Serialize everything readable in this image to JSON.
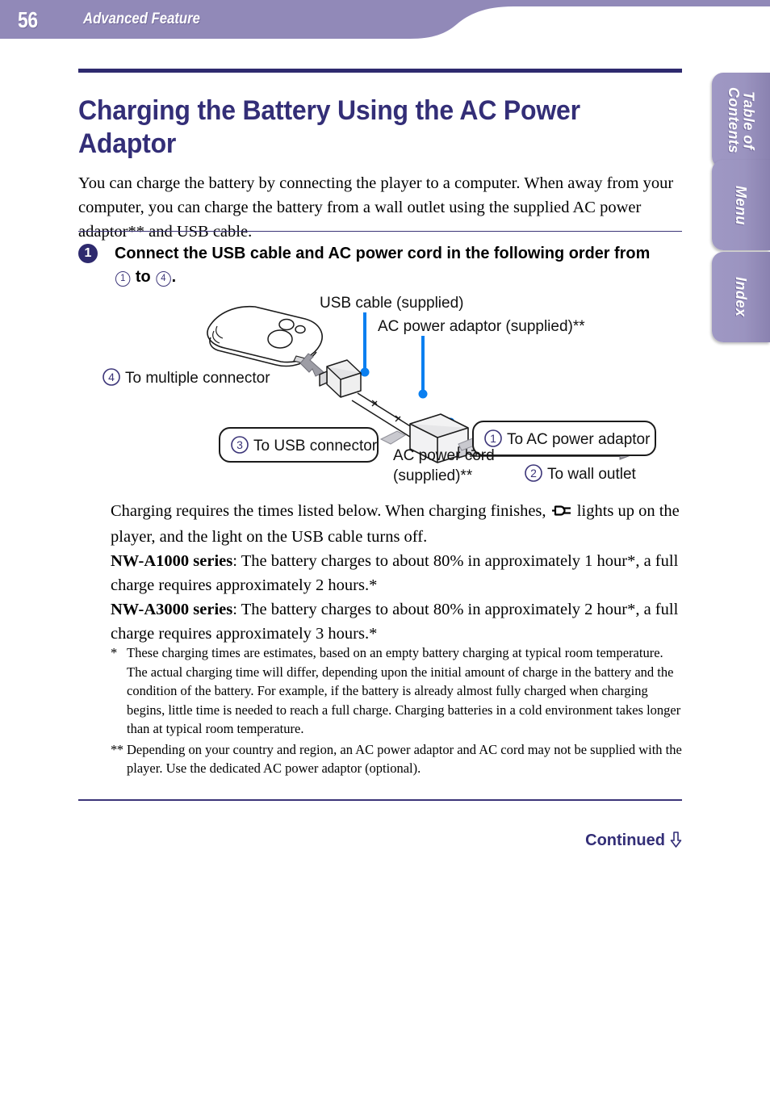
{
  "header": {
    "page_number": "56",
    "section_title": "Advanced Feature",
    "band_color": "#9189b8"
  },
  "side_tabs": [
    {
      "id": "toc",
      "label": "Table of\nContents"
    },
    {
      "id": "menu",
      "label": "Menu"
    },
    {
      "id": "index",
      "label": "Index"
    }
  ],
  "title": "Charging the Battery Using the AC Power Adaptor",
  "intro": "You can charge the battery by connecting the player to a computer. When away from your computer, you can charge the battery from a wall outlet using the supplied AC power adaptor** and USB cable.",
  "step": {
    "number": "1",
    "text_before": "Connect the USB cable and AC power cord in the following order from ",
    "circle_from": "1",
    "text_middle": " to ",
    "circle_to": "4",
    "text_after": "."
  },
  "diagram": {
    "labels": {
      "usb_cable": "USB cable (supplied)",
      "ac_power_adaptor": "AC power adaptor (supplied)**",
      "ac_power_cord_line1": "AC power cord",
      "ac_power_cord_line2": "(supplied)**"
    },
    "callouts": [
      {
        "number": "4",
        "text": "To multiple connector",
        "boxed": false
      },
      {
        "number": "3",
        "text": "To USB connector",
        "boxed": true
      },
      {
        "number": "1",
        "text": "To AC power adaptor",
        "boxed": true
      },
      {
        "number": "2",
        "text": "To wall outlet",
        "boxed": false
      }
    ]
  },
  "body": {
    "line1a": "Charging requires the times listed below. When charging finishes, ",
    "plug_icon": "plug-icon",
    "line1b": " lights up on the player, and the light on the USB cable turns off.",
    "series_a1000_label": "NW-A1000 series",
    "series_a1000_text": ": The battery charges to about 80% in approximately 1 hour*, a full charge requires approximately 2 hours.*",
    "series_a3000_label": "NW-A3000 series",
    "series_a3000_text": ": The battery charges to about 80% in approximately 2 hour*, a full charge requires approximately 3 hours.*"
  },
  "footnotes": [
    {
      "mark": "*",
      "text": "These charging times are estimates, based on an empty battery charging at typical room temperature. The actual charging time will differ, depending upon the initial amount of charge in the battery and the condition of the battery. For example, if the battery is already almost fully charged when charging begins, little time is needed to reach a full charge. Charging batteries in a cold environment takes longer than at typical room temperature."
    },
    {
      "mark": "**",
      "text": "Depending on your country and region, an AC power adaptor and AC cord may not be supplied with the player. Use the dedicated AC power adaptor (optional)."
    }
  ],
  "footer": {
    "continued": "Continued",
    "continued_icon": "arrow-down-icon"
  },
  "colors": {
    "header_purple": "#9189b8",
    "tab_purple": "#9b94c0",
    "title_indigo": "#332e77",
    "rule_indigo": "#2e2a6e",
    "diagram_blue": "#0a7ff0"
  }
}
